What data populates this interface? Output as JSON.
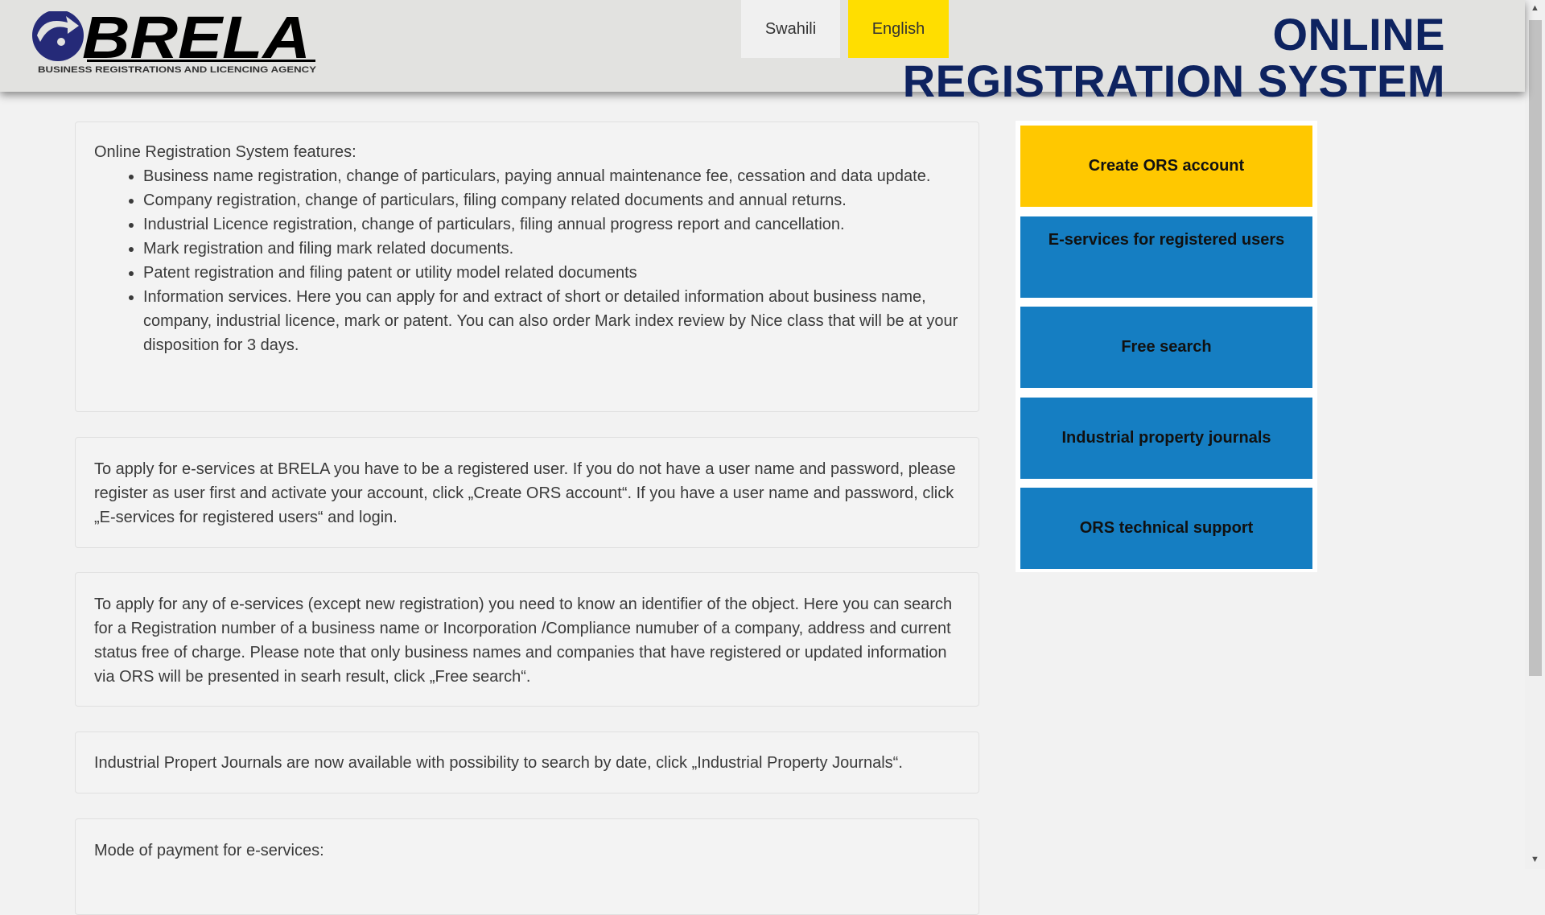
{
  "header": {
    "logo_text": "BRELA",
    "logo_subtitle": "BUSINESS REGISTRATIONS AND LICENCING AGENCY",
    "languages": [
      {
        "label": "Swahili"
      },
      {
        "label": "English",
        "active": true
      }
    ],
    "title_line1": "ONLINE",
    "title_line2": "REGISTRATION SYSTEM"
  },
  "content": {
    "features": {
      "intro": "Online Registration System features:",
      "items": [
        "Business name registration, change of particulars, paying annual maintenance fee, cessation and data update.",
        "Company registration, change of particulars, filing company related documents and annual returns.",
        "Industrial Licence registration, change of particulars, filing annual progress report and cancellation.",
        "Mark registration and filing mark related documents.",
        "Patent registration and filing patent or utility model related documents",
        "Information services. Here you can apply for and extract of short or detailed information about business name, company, industrial licence, mark or patent. You can also order Mark index review by Nice class that will be at your disposition for 3 days."
      ]
    },
    "apply_text": "To apply for e-services at BRELA you have to be a registered user. If you do not have a user name and password, please register as user first and activate your account, click „Create ORS account“. If you have a user name and password, click „E-services for registered users“ and login.",
    "search_text": "To apply for any of e-services (except new registration) you need to know an identifier of the object. Here you can search for a Registration number of a business name or Incorporation /Compliance numuber of a company, address and current status free of charge. Please note that only business names and companies that have registered or updated information via ORS will be presented in searh result, click „Free search“.",
    "journals_text": "Industrial Propert Journals are now available with possibility to search by date, click „Industrial Property Journals“.",
    "payment_intro": "Mode of payment for e-services:"
  },
  "sidebar": {
    "create_account": "Create ORS account",
    "eservices": "E-services for registered users",
    "free_search": "Free search",
    "journals": "Industrial property journals",
    "support": "ORS technical support"
  },
  "colors": {
    "yellow": "#ffc800",
    "blue": "#157ec2",
    "title": "#0e2360",
    "lang_active": "#ffde00"
  }
}
